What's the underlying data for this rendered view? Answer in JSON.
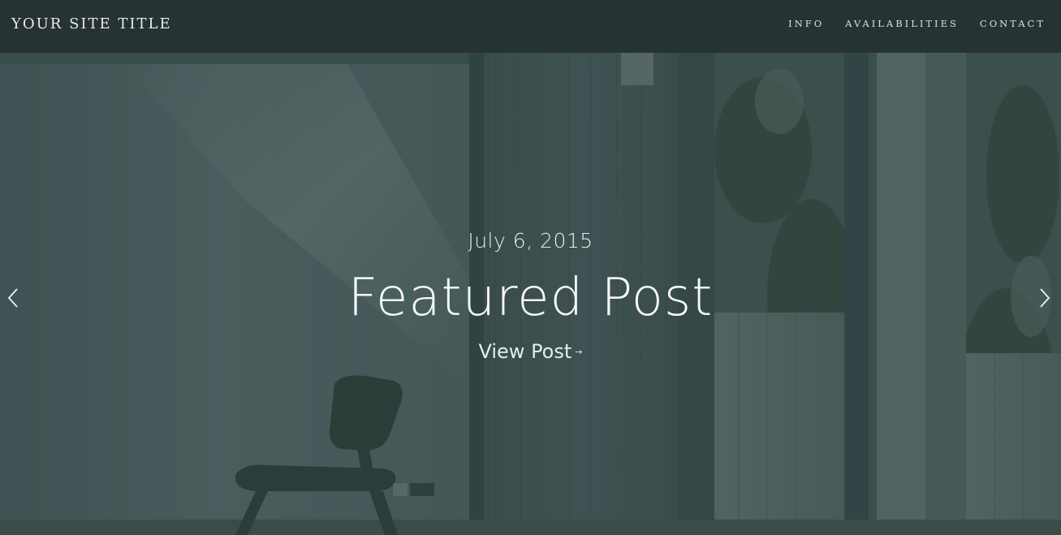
{
  "header": {
    "site_title": "YOUR SITE TITLE",
    "nav": [
      {
        "label": "INFO"
      },
      {
        "label": "AVAILABILITIES"
      },
      {
        "label": "CONTACT"
      }
    ]
  },
  "hero": {
    "date": "July 6, 2015",
    "title": "Featured Post",
    "link_label": "View Post",
    "link_arrow": "→",
    "prev_icon": "chevron-left-icon",
    "next_icon": "chevron-right-icon"
  },
  "colors": {
    "header_bg": "#263332",
    "overlay": "#3e5552",
    "text": "#f5f8f7"
  }
}
